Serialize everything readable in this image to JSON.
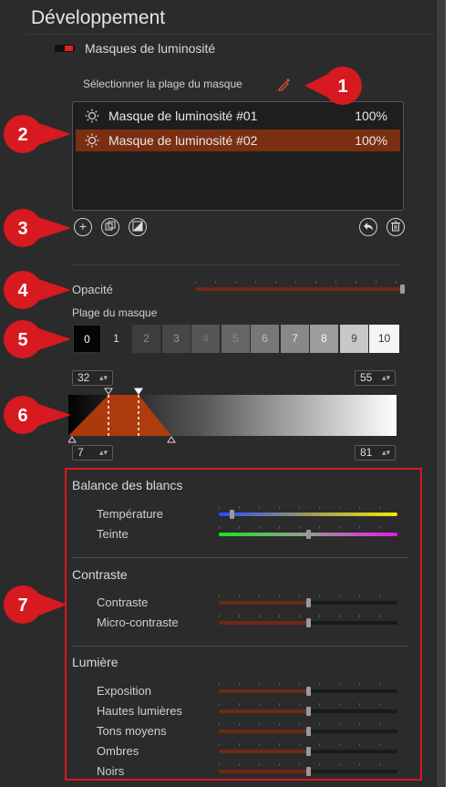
{
  "panel": {
    "title": "Développement",
    "masks_section_title": "Masques de luminosité",
    "select_range_label": "Sélectionner la plage du masque"
  },
  "masks": [
    {
      "name": "Masque de luminosité #01",
      "opacity": "100%",
      "selected": false
    },
    {
      "name": "Masque de luminosité #02",
      "opacity": "100%",
      "selected": true
    }
  ],
  "toolbar": {
    "add_icon": "plus-circle-icon",
    "duplicate_icon": "duplicate-icon",
    "invert_icon": "invert-mask-icon",
    "undo_icon": "undo-arrow-icon",
    "delete_icon": "trash-icon"
  },
  "opacity": {
    "label": "Opacité",
    "value": 1.0
  },
  "mask_range": {
    "label": "Plage du masque",
    "buttons": [
      "0",
      "1",
      "2",
      "3",
      "4",
      "5",
      "6",
      "7",
      "8",
      "9",
      "10"
    ],
    "top_left_value": "32",
    "top_right_value": "55",
    "bottom_left_value": "7",
    "bottom_right_value": "81"
  },
  "white_balance": {
    "title": "Balance des blancs",
    "temperature_label": "Température",
    "temperature_value": 0.06,
    "tint_label": "Teinte",
    "tint_value": 0.5
  },
  "contrast": {
    "title": "Contraste",
    "contrast_label": "Contraste",
    "contrast_value": 0.5,
    "micro_label": "Micro-contraste",
    "micro_value": 0.5
  },
  "light": {
    "title": "Lumière",
    "sliders": [
      {
        "label": "Exposition",
        "value": 0.5
      },
      {
        "label": "Hautes lumières",
        "value": 0.5
      },
      {
        "label": "Tons moyens",
        "value": 0.5
      },
      {
        "label": "Ombres",
        "value": 0.5
      },
      {
        "label": "Noirs",
        "value": 0.5
      }
    ]
  },
  "callouts": [
    "1",
    "2",
    "3",
    "4",
    "5",
    "6",
    "7"
  ],
  "colors": {
    "accent_red": "#d71920",
    "selection_brown": "#7a2e12",
    "panel_bg": "#2b2b2b"
  }
}
